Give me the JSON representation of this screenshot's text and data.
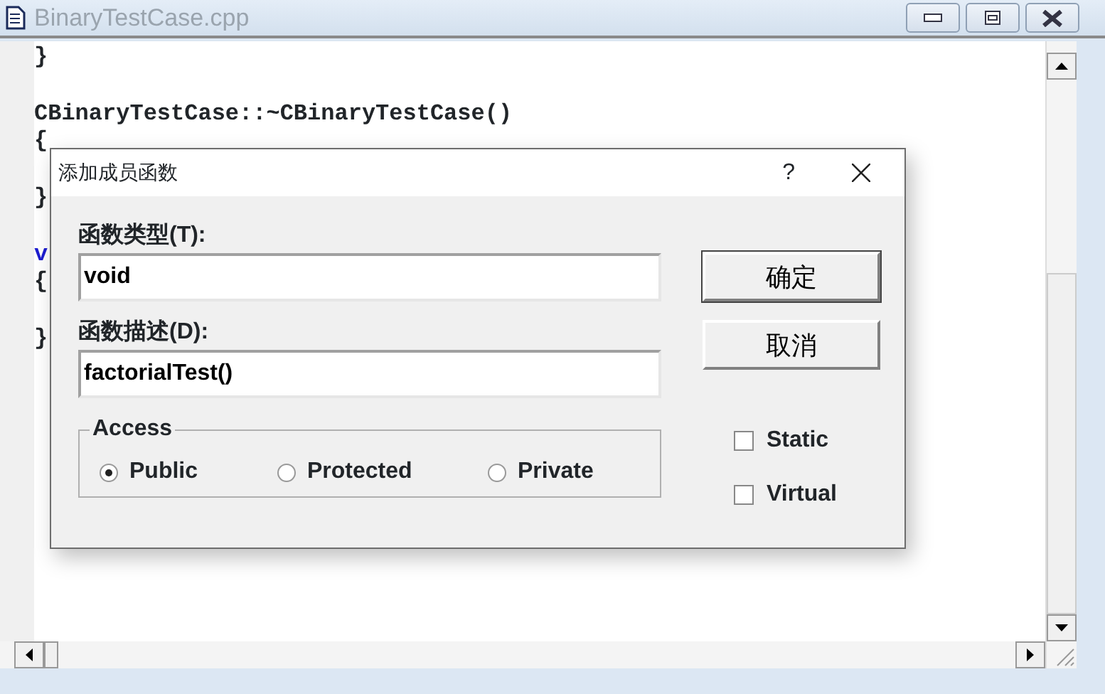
{
  "window": {
    "title": "BinaryTestCase.cpp"
  },
  "code_lines": [
    {
      "kind": "code",
      "text": "}"
    },
    {
      "kind": "blank"
    },
    {
      "kind": "code",
      "text": "CBinaryTestCase::~CBinaryTestCase()"
    },
    {
      "kind": "code",
      "text": "{"
    },
    {
      "kind": "blank"
    },
    {
      "kind": "code",
      "text": "}"
    },
    {
      "kind": "blank"
    },
    {
      "kind": "keyword",
      "text": "v"
    },
    {
      "kind": "code",
      "text": "{"
    },
    {
      "kind": "blank"
    },
    {
      "kind": "code",
      "text": "}"
    }
  ],
  "dialog": {
    "title": "添加成员函数",
    "help": "?",
    "type_label": "函数类型(T):",
    "type_value": "void",
    "desc_label": "函数描述(D):",
    "desc_value": "factorialTest()",
    "access": {
      "label": "Access",
      "options": [
        {
          "label": "Public",
          "selected": true
        },
        {
          "label": "Protected",
          "selected": false
        },
        {
          "label": "Private",
          "selected": false
        }
      ]
    },
    "buttons": [
      {
        "label": "确定",
        "default": true
      },
      {
        "label": "取消",
        "default": false
      }
    ],
    "checkboxes": [
      {
        "label": "Static",
        "checked": false
      },
      {
        "label": "Virtual",
        "checked": false
      }
    ]
  }
}
